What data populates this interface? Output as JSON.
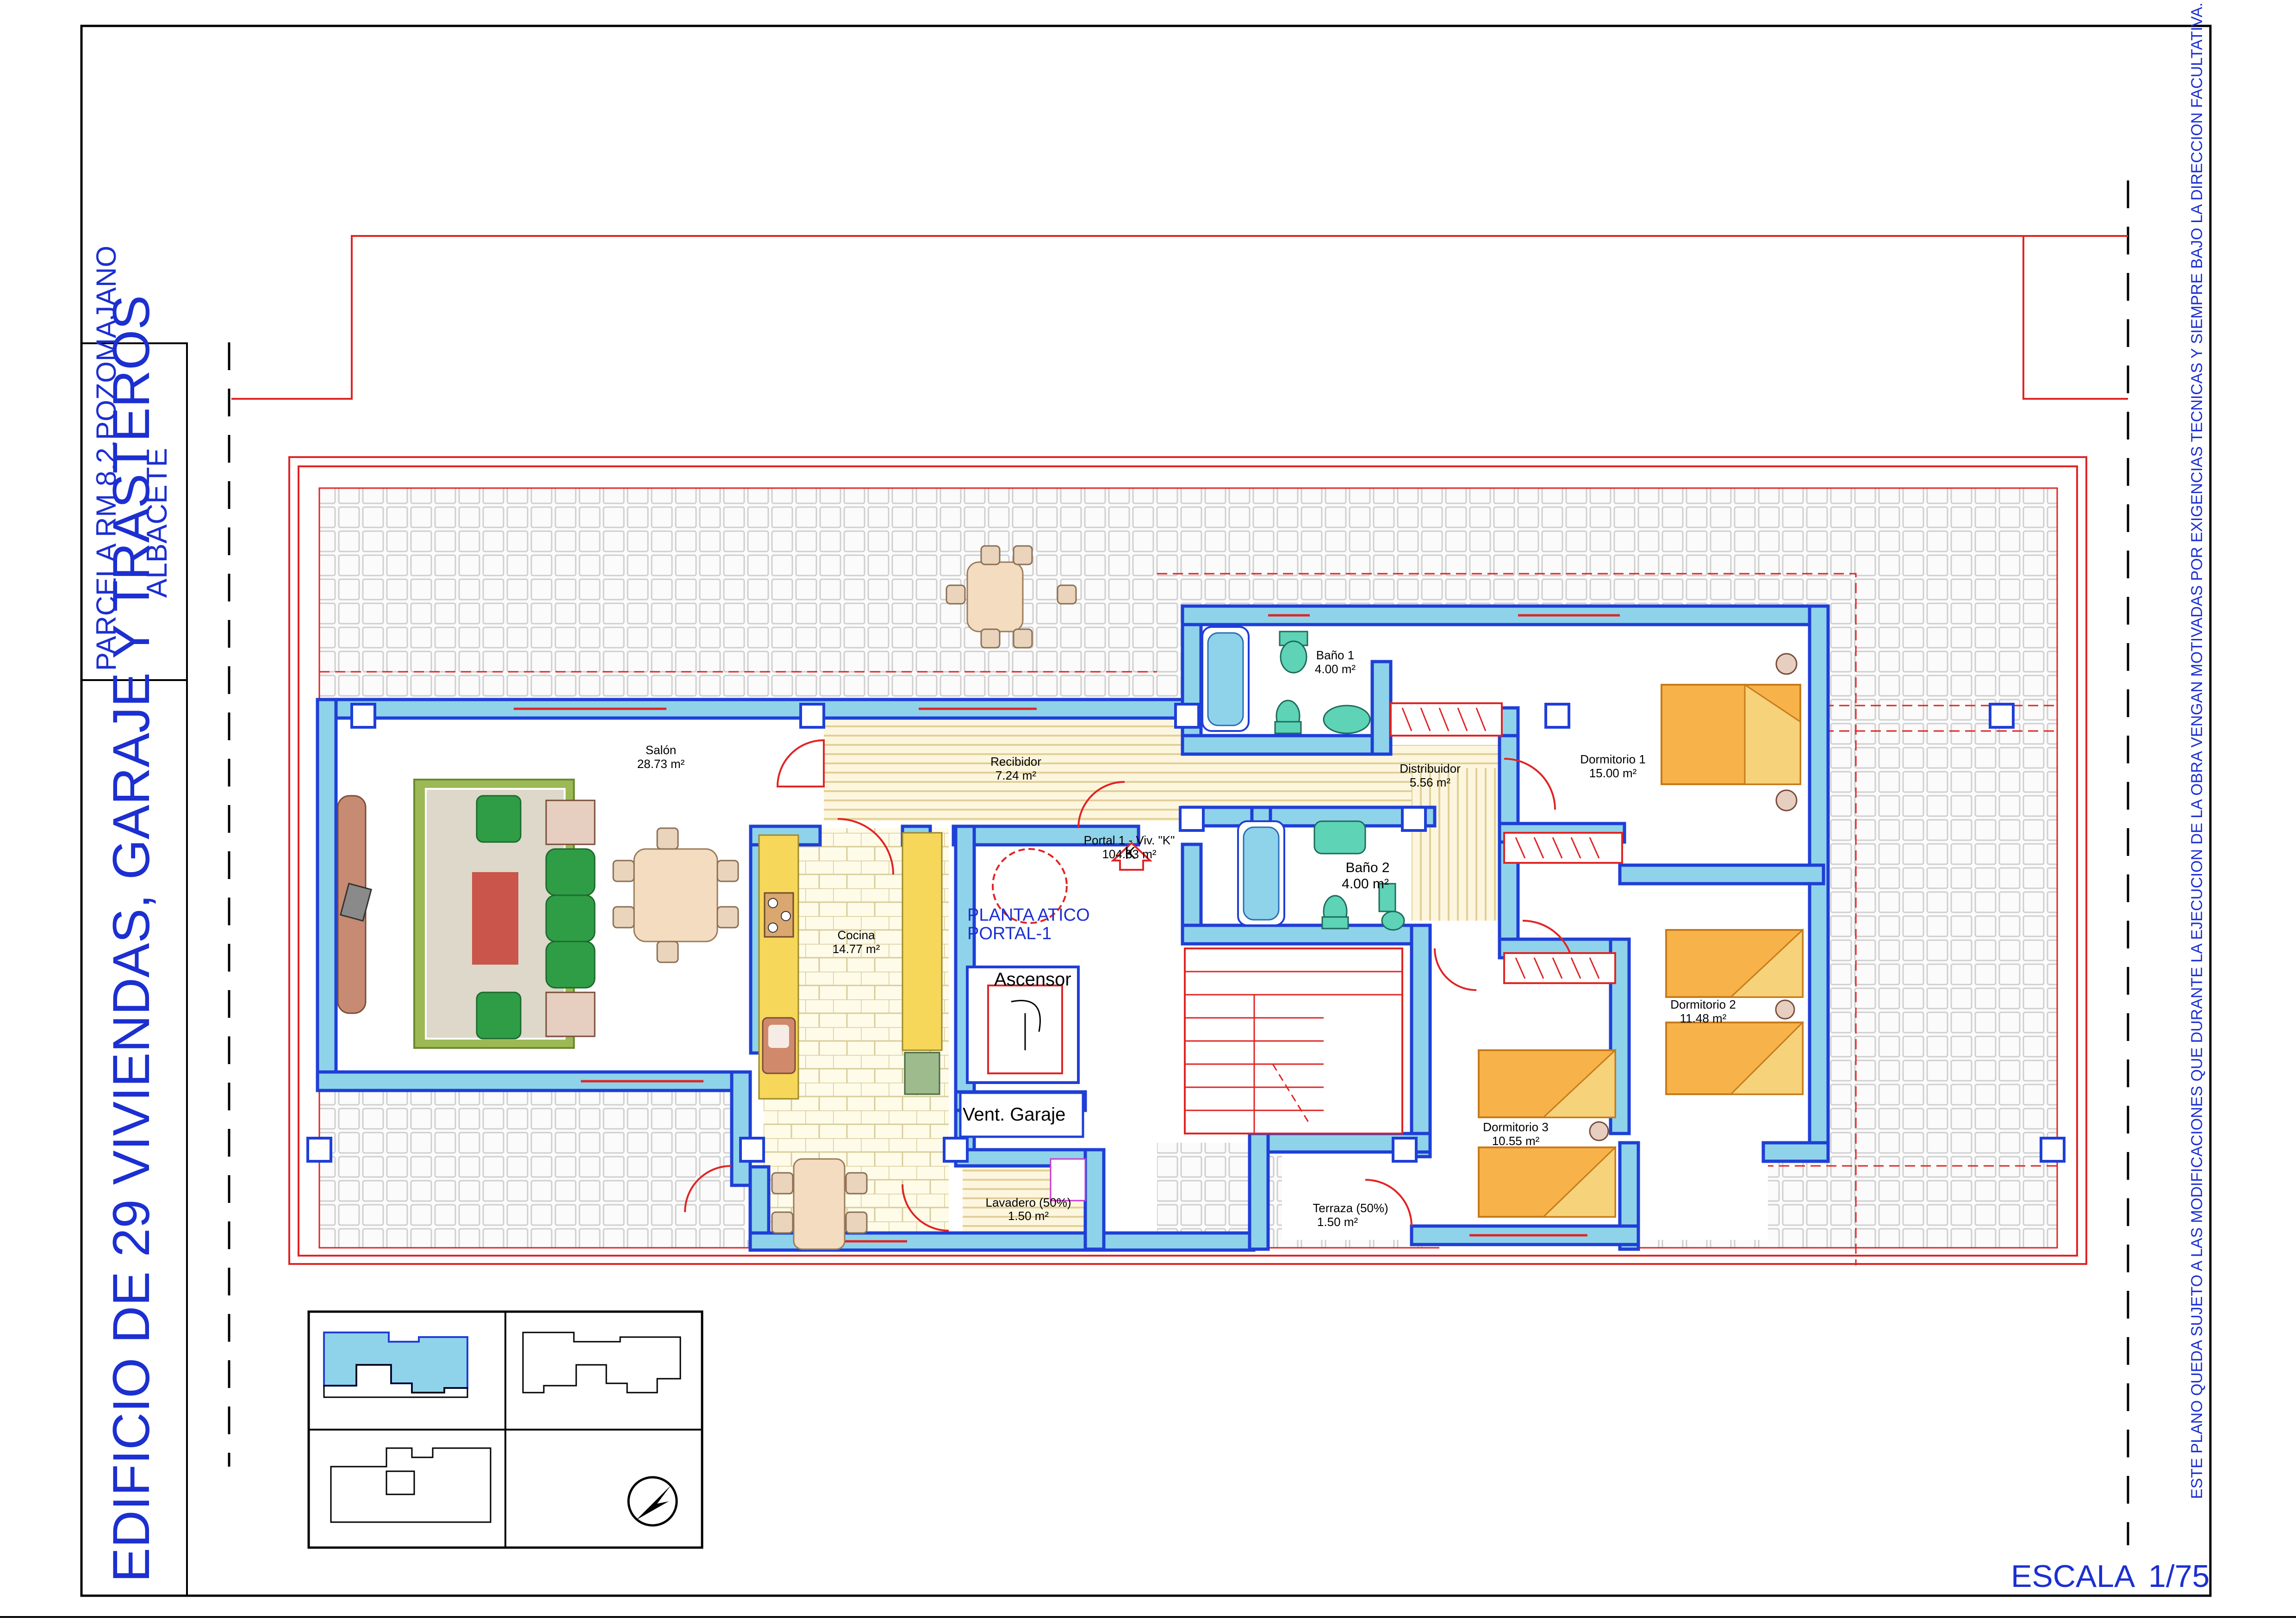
{
  "title_block": {
    "main_title": "EDIFICIO DE 29 VIVIENDAS, GARAJE Y TRASTEROS",
    "parcel": "PARCELA RM.8.2.POZOMAJANO",
    "city": "ALBACETE"
  },
  "side_note": "ESTE PLANO QUEDA SUJETO A LAS MODIFICACIONES QUE DURANTE LA EJECUCION DE LA OBRA VENGAN MOTIVADAS POR EXIGENCIAS TECNICAS Y SIEMPRE BAJO LA DIRECCION FACULTATIVA.",
  "scale": {
    "label": "ESCALA",
    "value": "1/75"
  },
  "plan_heading": {
    "line1": "PLANTA ATICO",
    "line2": "PORTAL-1"
  },
  "dwelling": {
    "name": "Portal 1 - Viv. \"K\"",
    "area": "104.33 m²",
    "letter": "K"
  },
  "rooms": [
    {
      "id": "salon",
      "name": "Salón",
      "area": "28.73 m²"
    },
    {
      "id": "recibidor",
      "name": "Recibidor",
      "area": "7.24 m²"
    },
    {
      "id": "cocina",
      "name": "Cocina",
      "area": "14.77 m²"
    },
    {
      "id": "bano1",
      "name": "Baño 1",
      "area": "4.00 m²"
    },
    {
      "id": "bano2",
      "name": "Baño 2",
      "area": "4.00 m²"
    },
    {
      "id": "distribuidor",
      "name": "Distribuidor",
      "area": "5.56 m²"
    },
    {
      "id": "dormitorio1",
      "name": "Dormitorio 1",
      "area": "15.00 m²"
    },
    {
      "id": "dormitorio2",
      "name": "Dormitorio 2",
      "area": "11.48 m²"
    },
    {
      "id": "dormitorio3",
      "name": "Dormitorio 3",
      "area": "10.55 m²"
    },
    {
      "id": "lavadero",
      "name": "Lavadero (50%)",
      "area": "1.50 m²"
    },
    {
      "id": "terraza",
      "name": "Terraza (50%)",
      "area": "1.50 m²"
    }
  ],
  "labels": {
    "ascensor": "Ascensor",
    "vent_garaje": "Vent. Garaje"
  },
  "colors": {
    "wall_fill": "#8fd3ea",
    "wall_stroke": "#1f3fd6",
    "title_blue": "#1c2fd1",
    "cad_red": "#e02424",
    "bed": "#f8b24a"
  },
  "icons": [
    "north-arrow-icon",
    "bed-icon",
    "sofa-icon",
    "dining-table-icon",
    "bathtub-icon",
    "toilet-icon",
    "sink-icon",
    "stove-icon",
    "elevator-icon"
  ]
}
